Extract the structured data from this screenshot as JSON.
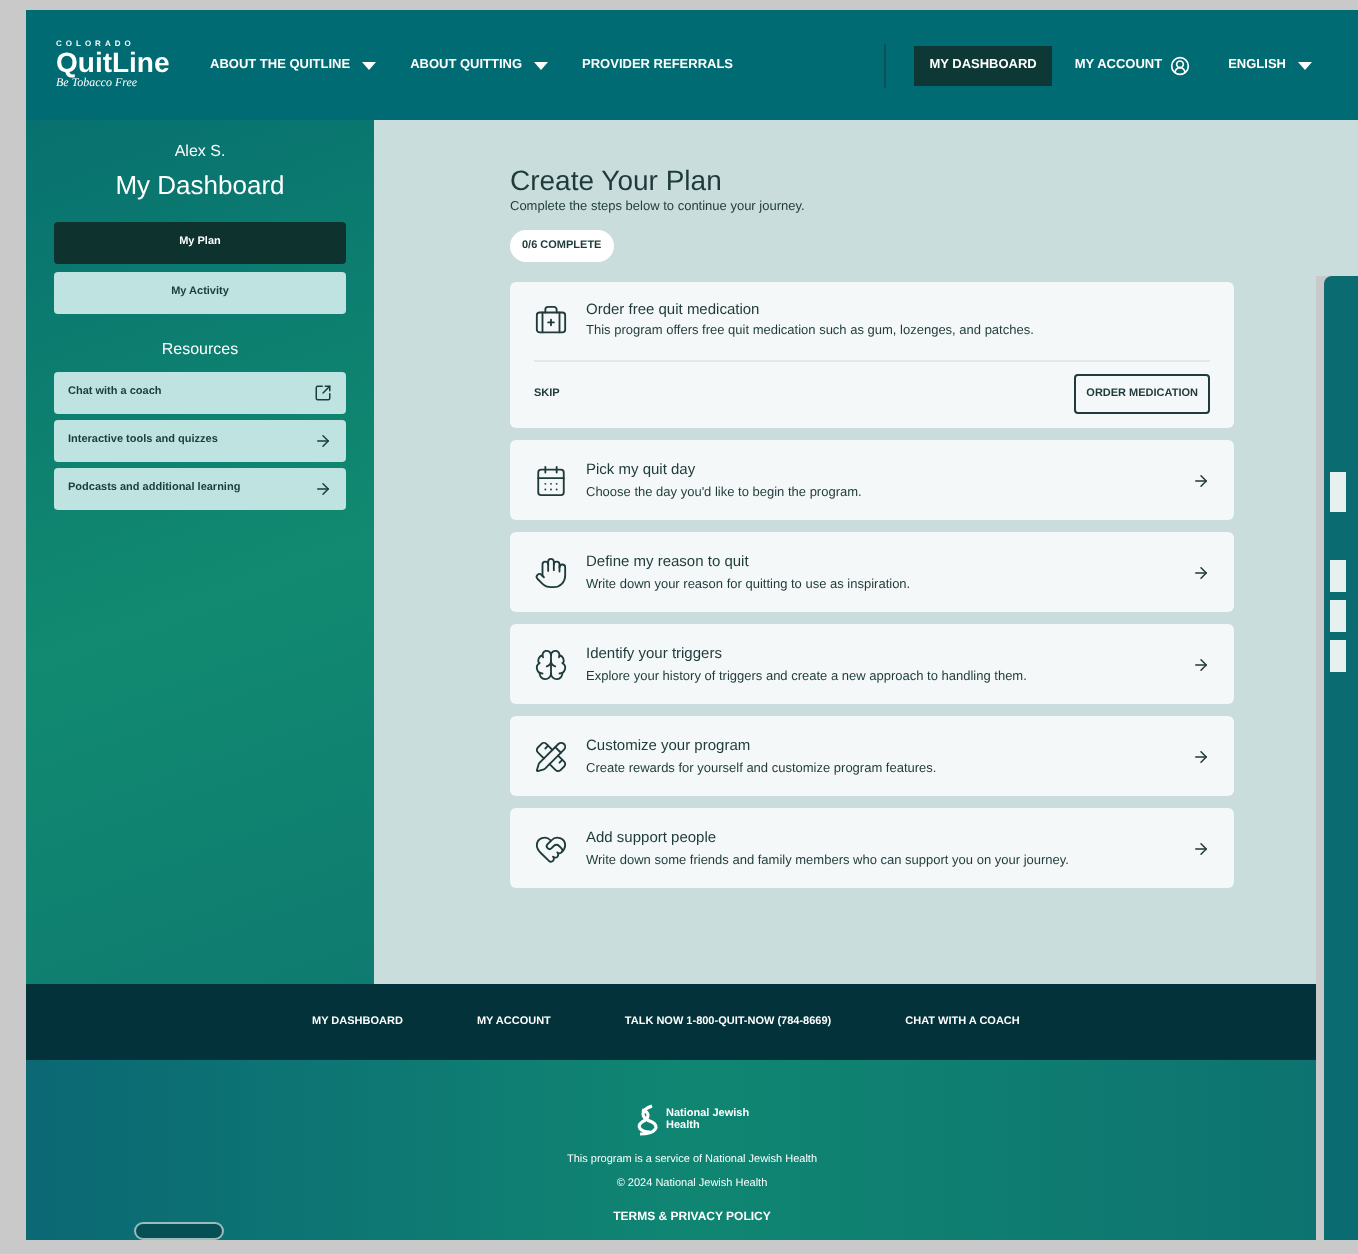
{
  "header": {
    "logo": {
      "top": "COLORADO",
      "name": "QuitLine",
      "tagline": "Be Tobacco Free"
    },
    "nav": [
      {
        "label": "ABOUT THE QUITLINE",
        "dropdown": true
      },
      {
        "label": "ABOUT QUITTING",
        "dropdown": true
      },
      {
        "label": "PROVIDER REFERRALS",
        "dropdown": false
      }
    ],
    "right_nav": [
      {
        "label": "MY DASHBOARD",
        "kind": "link",
        "selected": true
      },
      {
        "label": "MY ACCOUNT",
        "kind": "account",
        "selected": false
      },
      {
        "label": "ENGLISH",
        "kind": "language",
        "selected": false
      }
    ]
  },
  "sidebar": {
    "user": "Alex S.",
    "title": "My Dashboard",
    "tabs": [
      {
        "label": "My Plan",
        "selected": true
      },
      {
        "label": "My Activity",
        "selected": false
      }
    ],
    "resources_title": "Resources",
    "resources": [
      {
        "label": "Chat with a coach",
        "kind": "external"
      },
      {
        "label": "Interactive tools and quizzes",
        "kind": "link"
      },
      {
        "label": "Podcasts and additional learning",
        "kind": "link"
      }
    ]
  },
  "plan": {
    "title": "Create Your Plan",
    "subtitle": "Complete the steps below to continue your journey.",
    "progress": "0/6 COMPLETE",
    "steps": [
      {
        "kind": "action",
        "title": "Order free quit medication",
        "description": "This program offers free quit medication such as gum, lozenges, and patches.",
        "skip": "SKIP",
        "button": "ORDER MEDICATION"
      },
      {
        "kind": "link",
        "title": "Pick my quit day",
        "description": "Choose the day you'd like to begin the program."
      },
      {
        "kind": "link",
        "title": "Define my reason to quit",
        "description": "Write down your reason for quitting to use as inspiration."
      },
      {
        "kind": "link",
        "title": "Identify your triggers",
        "description": "Explore your history of triggers and create a new approach to handling them."
      },
      {
        "kind": "link",
        "title": "Customize your program",
        "description": "Create rewards for yourself and customize program features."
      },
      {
        "kind": "link",
        "title": "Add support people",
        "description": "Write down some friends and family members who can support you on your journey."
      }
    ]
  },
  "footer_nav": [
    "MY DASHBOARD",
    "MY ACCOUNT",
    "TALK NOW 1-800-QUIT-NOW (784-8669)",
    "CHAT WITH A COACH"
  ],
  "footer": {
    "logo": "National Jewish Health",
    "service": "This program is a service of National Jewish Health",
    "copyright": "© 2024 National Jewish Health",
    "terms": "TERMS & PRIVACY POLICY"
  }
}
